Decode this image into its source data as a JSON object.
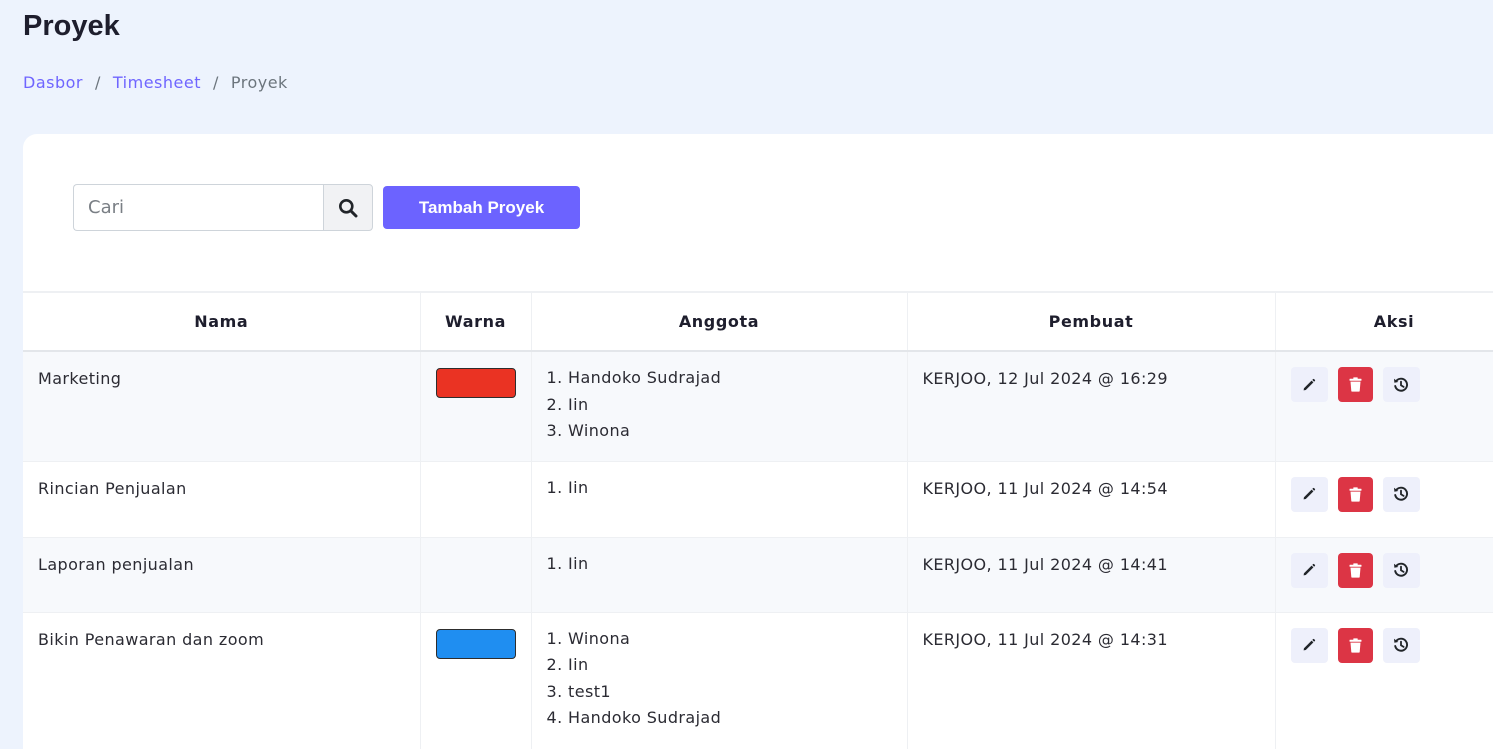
{
  "page": {
    "title": "Proyek"
  },
  "breadcrumb": {
    "items": [
      "Dasbor",
      "Timesheet",
      "Proyek"
    ],
    "separator": "/"
  },
  "toolbar": {
    "search_placeholder": "Cari",
    "search_value": "",
    "add_label": "Tambah Proyek"
  },
  "table": {
    "headers": [
      "Nama",
      "Warna",
      "Anggota",
      "Pembuat",
      "Aksi"
    ],
    "rows": [
      {
        "name": "Marketing",
        "color": "#ea3323",
        "members": [
          "1. Handoko Sudrajad",
          "2. Iin",
          "3. Winona"
        ],
        "creator": "KERJOO, 12 Jul 2024 @ 16:29"
      },
      {
        "name": "Rincian Penjualan",
        "color": "",
        "members": [
          "1. Iin"
        ],
        "creator": "KERJOO, 11 Jul 2024 @ 14:54"
      },
      {
        "name": "Laporan penjualan",
        "color": "",
        "members": [
          "1. Iin"
        ],
        "creator": "KERJOO, 11 Jul 2024 @ 14:41"
      },
      {
        "name": "Bikin Penawaran dan zoom",
        "color": "#1f8ef1",
        "members": [
          "1. Winona",
          "2. Iin",
          "3. test1",
          "4. Handoko Sudrajad"
        ],
        "creator": "KERJOO, 11 Jul 2024 @ 14:31"
      }
    ]
  },
  "icons": {
    "search": "search-icon",
    "edit": "pencil-icon",
    "delete": "trash-icon",
    "history": "history-icon"
  },
  "colors": {
    "accent": "#6c63ff",
    "danger": "#dc3545",
    "breadcrumb_link": "#6f65ff"
  }
}
